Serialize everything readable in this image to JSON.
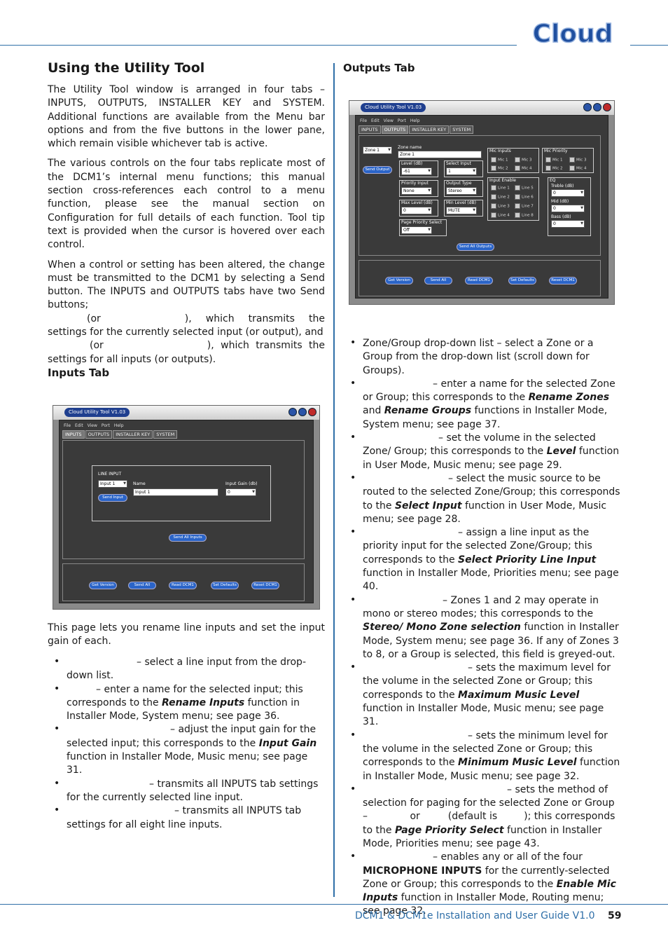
{
  "header": {
    "logo_text": "Cloud",
    "title": "Using the Utility Tool"
  },
  "intro": {
    "p1": "The Utility Tool window is arranged in four tabs – INPUTS, OUTPUTS, INSTALLER KEY and SYSTEM. Additional functions are available from the Menu bar options and from the five buttons in the lower pane, which remain visible whichever tab is active.",
    "p2": "The various controls on the four tabs replicate most of the DCM1’s internal menu functions; this manual section cross-references each control to a menu function, please see the manual section on Configuration for full details of each function. Tool tip text is provided when the cursor is hovered over each control.",
    "p3a": "When a control or setting has been altered, the change must be transmitted to the DCM1 by selecting a Send button. The INPUTS and OUTPUTS tabs have two Send buttons;",
    "p3b": "(or",
    "p3c": "), which transmits the settings for the currently selected input (or output), and",
    "p3d": "(or",
    "p3e": "), which transmits the settings for all inputs (or outputs)."
  },
  "inputs_tab": {
    "heading": "Inputs Tab",
    "description": "This page lets you rename line inputs and set the input gain of each.",
    "bullets": [
      {
        "pre": "",
        "text": "– select a line input from the drop-down list."
      },
      {
        "text": "– enter a name for the selected input; this corresponds to the ",
        "b1": "Rename Inputs",
        "t2": " function in Installer Mode, System menu; see page 36."
      },
      {
        "text": "– adjust the input gain for the selected input; this corresponds to the ",
        "b1": "Input Gain",
        "t2": " function in Installer Mode, Music menu; see page 31."
      },
      {
        "text": "– transmits all INPUTS tab settings for the currently selected line input."
      },
      {
        "text": "– transmits all INPUTS tab settings for all eight line inputs."
      }
    ]
  },
  "outputs_tab": {
    "heading": "Outputs Tab",
    "bullets": [
      {
        "text": "Zone/Group drop-down list – select a Zone or a Group from the drop-down list (scroll down for Groups)."
      },
      {
        "text": "– enter a name for the selected Zone or Group; this corresponds to the ",
        "b1": "Rename Zones",
        "t2": " and ",
        "b2": "Rename Groups",
        "t3": " functions in Installer Mode, System menu; see page 37."
      },
      {
        "text": "– set the volume in the selected Zone/ Group; this corresponds to the ",
        "b1": "Level",
        "t2": " function in User Mode, Music menu; see page 29."
      },
      {
        "text": "– select the music source to be routed to the selected Zone/Group; this corresponds to the ",
        "b1": "Select Input",
        "t2": " function in User Mode, Music menu; see page 28."
      },
      {
        "text": "– assign a line input as the priority input for the selected Zone/Group; this corresponds to the ",
        "b1": "Select Priority Line Input",
        "t2": " function in Installer Mode, Priorities menu; see page 40."
      },
      {
        "text": "– Zones 1 and 2 may operate in mono or stereo modes; this corresponds to the ",
        "b1": "Stereo/ Mono Zone selection",
        "t2": " function in Installer Mode, System menu; see page 36. If any of Zones 3 to 8, or a Group is selected, this field is greyed-out."
      },
      {
        "text": "– sets the maximum level for the volume in the selected Zone or Group; this corresponds to the ",
        "b1": "Maximum Music Level",
        "t2": " function in Installer Mode, Music menu; see page 31."
      },
      {
        "text": "– sets the minimum level for the volume in the selected Zone or Group; this corresponds to the ",
        "b1": "Minimum Music Level",
        "t2": " function in Installer Mode, Music menu; see page 32."
      },
      {
        "text": "– sets the method of selection for paging for the selected Zone or Group – ",
        "t_or": "or",
        "t_def": "(default is",
        "t_end": "); this corresponds to the ",
        "b1": "Page Priority Select",
        "t2": " function in Installer Mode, Priorities menu; see page 43."
      },
      {
        "text": "– enables any or all of the four ",
        "b_plain": "MICROPHONE INPUTS",
        "t2": " for the currently-selected Zone or Group; this corresponds to the ",
        "b1": "Enable Mic Inputs",
        "t3": " function in Installer Mode, Routing menu; see page 32."
      }
    ]
  },
  "footer": {
    "guide": "DCM1 & DCM1e Installation and User Guide V1.0",
    "page": "59"
  },
  "screenshot_inputs": {
    "window_title": "Cloud Utility Tool V1.03",
    "menu": [
      "File",
      "Edit",
      "View",
      "Port",
      "Help"
    ],
    "tabs": [
      "INPUTS",
      "OUTPUTS",
      "INSTALLER KEY",
      "SYSTEM"
    ],
    "group_label": "LINE INPUT",
    "input_select": "Input 1",
    "name_label": "Name",
    "name_value": "Input 1",
    "gain_label": "Input Gain (db)",
    "gain_value": "0",
    "send_input": "Send Input",
    "send_all_inputs": "Send All Inputs",
    "buttons": [
      "Get Version",
      "Send All",
      "Read DCM1",
      "Set Defaults",
      "Reset DCM1"
    ]
  },
  "screenshot_outputs": {
    "window_title": "Cloud Utility Tool V1.03",
    "menu": [
      "File",
      "Edit",
      "View",
      "Port",
      "Help"
    ],
    "tabs": [
      "INPUTS",
      "OUTPUTS",
      "INSTALLER KEY",
      "SYSTEM"
    ],
    "zone_select": "Zone 1",
    "zone_name_label": "Zone name",
    "zone_name_value": "Zone 1",
    "send_output": "Send Output",
    "level_label": "Level (dB)",
    "level_value": "-61",
    "select_input_label": "Select Input",
    "select_input_value": "1",
    "priority_label": "Priority Input",
    "priority_value": "None",
    "output_type_label": "Output Type",
    "output_type_value": "Stereo",
    "max_label": "Max Level (dB)",
    "max_value": "0",
    "min_label": "Min Level (dB)",
    "min_value": "MUTE",
    "page_label": "Page Priority Select",
    "page_value": "Off",
    "mic_inputs_label": "Mic Inputs",
    "mic_priority_label": "Mic Priority",
    "input_enable_label": "Input Enable",
    "eq_label": "EQ",
    "treble_label": "Treble (dB)",
    "treble_value": "0",
    "mid_label": "Mid (dB)",
    "mid_value": "0",
    "bass_label": "Bass (dB)",
    "bass_value": "0",
    "mics": [
      "Mic 1",
      "Mic 3",
      "Mic 2",
      "Mic 4"
    ],
    "lines": [
      "Line 1",
      "Line 5",
      "Line 2",
      "Line 6",
      "Line 3",
      "Line 7",
      "Line 4",
      "Line 8"
    ],
    "send_all_outputs": "Send All Outputs",
    "buttons": [
      "Get Version",
      "Send All",
      "Read DCM1",
      "Set Defaults",
      "Reset DCM1"
    ]
  },
  "colors": {
    "accent": "#2f6fa8"
  }
}
